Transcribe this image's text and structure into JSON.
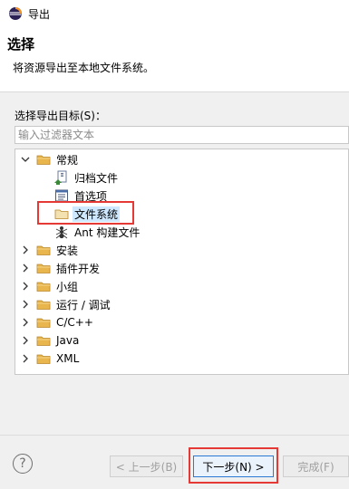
{
  "titlebar": {
    "title": "导出",
    "icon": "eclipse-icon"
  },
  "banner": {
    "heading": "选择",
    "description": "将资源导出至本地文件系统。"
  },
  "target": {
    "label": "选择导出目标(S)：",
    "filter_placeholder": "输入过滤器文本"
  },
  "tree": {
    "general": {
      "label": "常规",
      "expanded": true,
      "children": [
        {
          "label": "归档文件",
          "icon": "archive-file-icon"
        },
        {
          "label": "首选项",
          "icon": "preferences-icon"
        },
        {
          "label": "文件系统",
          "icon": "folder-icon",
          "selected": true
        },
        {
          "label": "Ant 构建文件",
          "icon": "ant-icon"
        }
      ]
    },
    "categories": [
      {
        "label": "安装"
      },
      {
        "label": "插件开发"
      },
      {
        "label": "小组"
      },
      {
        "label": "运行 / 调试"
      },
      {
        "label": "C/C++"
      },
      {
        "label": "Java"
      },
      {
        "label": "XML"
      }
    ]
  },
  "buttons": {
    "back": "< 上一步(B)",
    "next": "下一步(N) >",
    "finish": "完成(F)"
  },
  "help": {
    "symbol": "?"
  },
  "colors": {
    "highlight": "#e53935",
    "selection": "#cde8ff",
    "folder": "#e8b64c"
  }
}
